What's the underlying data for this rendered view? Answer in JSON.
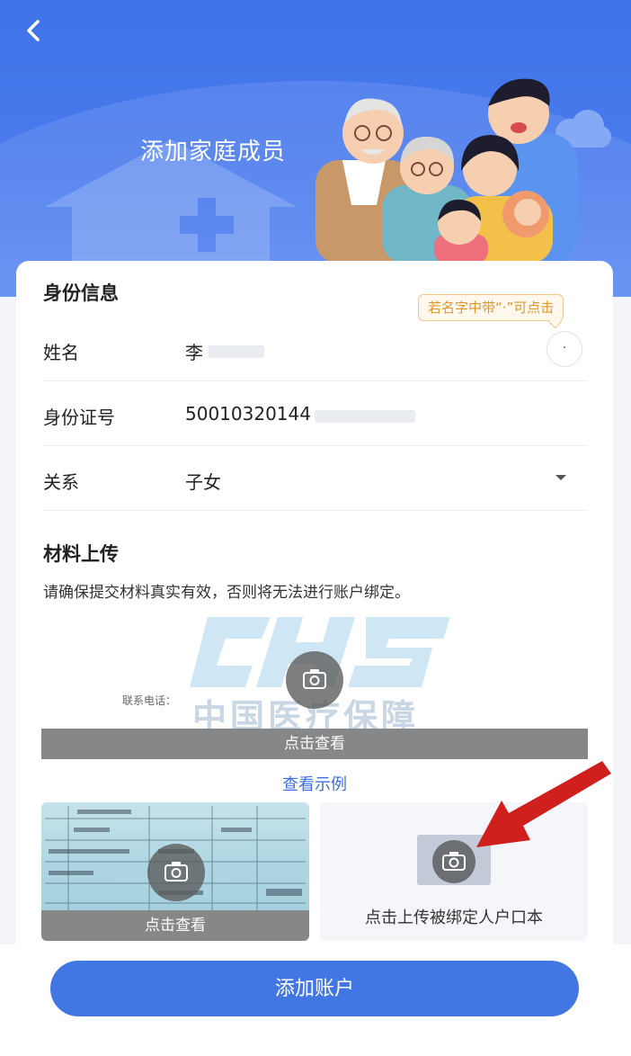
{
  "header": {
    "title": "添加家庭成员",
    "back_icon": "chevron-left-icon"
  },
  "identity": {
    "section_title": "身份信息",
    "tooltip": "若名字中带“·”可点击",
    "name_label": "姓名",
    "name_value": "李",
    "name_dot_button": "·",
    "id_label": "身份证号",
    "id_value": "50010320144",
    "relation_label": "关系",
    "relation_value": "子女"
  },
  "materials": {
    "section_title": "材料上传",
    "notice": "请确保提交材料真实有效，否则将无法进行账户绑定。",
    "example_watermark": "中国医疗保障",
    "example_contact": "联系电话：",
    "view_label": "点击查看",
    "example_link": "查看示例",
    "thumb_view_label": "点击查看",
    "upload_label": "点击上传被绑定人户口本"
  },
  "footer": {
    "submit_label": "添加账户"
  },
  "colors": {
    "primary": "#4277e3",
    "header": "#3f73e8",
    "tooltip_text": "#e3962e",
    "arrow": "#d0201e"
  }
}
